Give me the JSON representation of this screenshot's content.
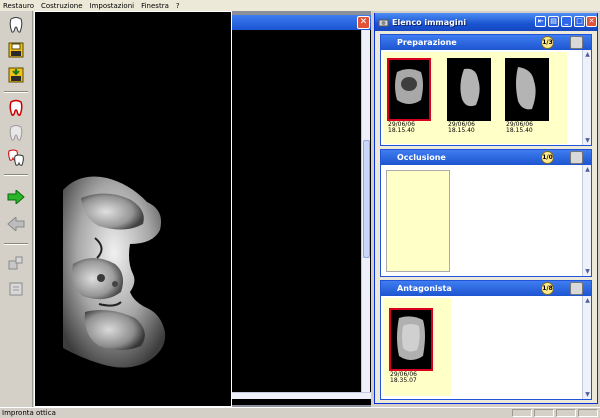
{
  "menu": [
    "Restauro",
    "Costruzione",
    "Impostazioni",
    "Finestra",
    "?"
  ],
  "toolbar": {
    "buttons": [
      "tooth-icon",
      "save-yellow-icon",
      "save-yellow-arrow-icon",
      "tooth-red-icon",
      "tooth-grey-icon",
      "tooth-pair-icon",
      "arrow-right-green-icon",
      "arrow-left-grey-icon",
      "tool-grey-icon",
      "doc-grey-icon"
    ]
  },
  "image_panel": {
    "title": "Elenco immagini",
    "sections": [
      {
        "name": "Preparazione",
        "counter": "1/3",
        "thumbnails": [
          {
            "date": "29/06/06",
            "time": "18.15.40",
            "selected": true
          },
          {
            "date": "29/06/06",
            "time": "18.15.40",
            "selected": false
          },
          {
            "date": "29/06/06",
            "time": "18.15.40",
            "selected": false
          }
        ]
      },
      {
        "name": "Occlusione",
        "counter": "1/0",
        "thumbnails": []
      },
      {
        "name": "Antagonista",
        "counter": "1/8",
        "thumbnails": [
          {
            "date": "29/06/06",
            "time": "18.35.07",
            "selected": true
          }
        ]
      }
    ]
  },
  "status": {
    "text": "Impronta ottica"
  },
  "colors": {
    "accent": "#1a54d2",
    "selection": "#d8001c",
    "thumb_bg": "#ffffc8"
  }
}
